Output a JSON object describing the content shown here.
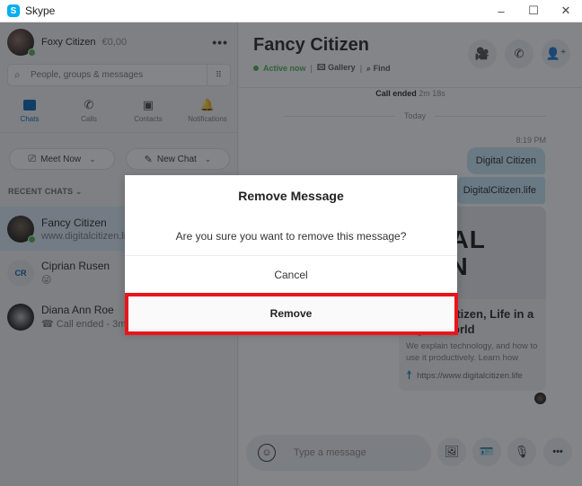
{
  "window": {
    "app_name": "Skype",
    "logo_glyph": "S",
    "minimize_icon": "–",
    "maximize_icon": "☐",
    "close_icon": "✕"
  },
  "sidebar": {
    "profile": {
      "name": "Foxy Citizen",
      "credit": "€0,00",
      "more_icon": "•••"
    },
    "search": {
      "placeholder": "People, groups & messages",
      "search_icon": "⌕",
      "dialpad_icon": "⠿"
    },
    "nav": [
      {
        "label": "Chats",
        "active": true
      },
      {
        "label": "Calls",
        "icon": "✆"
      },
      {
        "label": "Contacts",
        "icon": "▣"
      },
      {
        "label": "Notifications",
        "icon": "🔔"
      }
    ],
    "meet_now": {
      "label": "Meet Now",
      "icon": "⎚",
      "chevron": "⌄"
    },
    "new_chat": {
      "label": "New Chat",
      "icon": "✎",
      "chevron": "⌄"
    },
    "recent_header": "RECENT CHATS ⌄",
    "chats": [
      {
        "name": "Fancy Citizen",
        "preview": "www.digitalcitizen.life",
        "selected": true,
        "online": true
      },
      {
        "name": "Ciprian Rusen",
        "initials": "CR",
        "preview": "😜"
      },
      {
        "name": "Diana Ann Roe",
        "preview": "☎ Call ended - 3m"
      }
    ]
  },
  "main": {
    "title": "Fancy Citizen",
    "status": "Active now",
    "separator": "|",
    "gallery": "🖾 Gallery",
    "find": "⌕ Find",
    "video_icon": "🎥",
    "call_icon": "✆",
    "add_person_icon": "👤⁺",
    "call_ended_label": "Call ended",
    "call_ended_duration": "2m 18s",
    "day_separator": "Today",
    "message_time": "8:19 PM",
    "messages": [
      "Digital Citizen",
      "DigitalCitizen.life"
    ],
    "link_card": {
      "image_line1": "GITAL",
      "image_line2": "IZEN",
      "title": "Digital Citizen, Life in a digital world",
      "description": "We explain technology, and how to use it productively. Learn how",
      "url": "https://www.digitalcitizen.life",
      "url_icon": "☨"
    },
    "composer": {
      "placeholder": "Type a message",
      "emoji_icon": "☺",
      "media_icon": "🖼",
      "contact_card_icon": "🪪",
      "mic_icon": "🎙",
      "more_icon": "•••"
    }
  },
  "dialog": {
    "title": "Remove Message",
    "message": "Are you sure you want to remove this message?",
    "cancel_label": "Cancel",
    "remove_label": "Remove",
    "highlight_color": "#e8161b"
  }
}
